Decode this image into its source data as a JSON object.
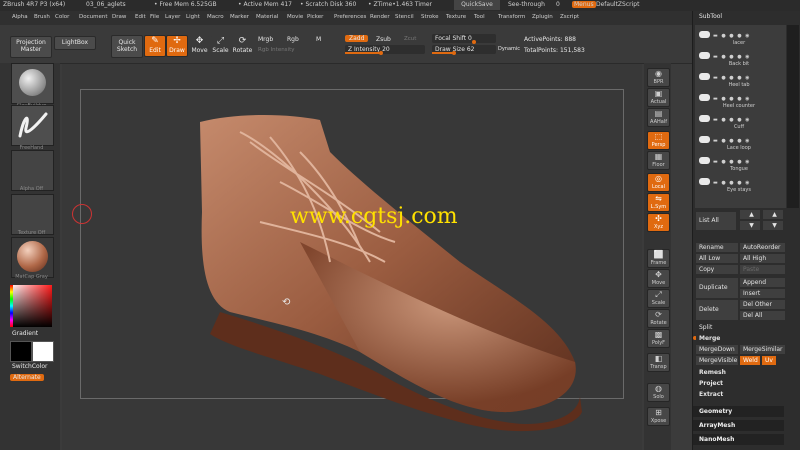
{
  "titlebar": {
    "app_info": "ZBrush 4R7 P3 (x64)",
    "file_name": "03_06_aglets",
    "free_mem": "• Free Mem 6.525GB",
    "active_mem": "• Active Mem 417",
    "scratch": "• Scratch Disk 360",
    "ztime": "• ZTime•1.463 Timer",
    "quicksave": "QuickSave",
    "seethrough": "See-through",
    "seethrough_val": "0",
    "menus": "Menus",
    "script": "DefaultZScript"
  },
  "menubar": [
    "Alpha",
    "Brush",
    "Color",
    "Document",
    "Draw",
    "Edit",
    "File",
    "Layer",
    "Light",
    "Macro",
    "Marker",
    "Material",
    "Movie",
    "Picker",
    "Preferences",
    "Render",
    "Stencil",
    "Stroke",
    "Texture",
    "Tool",
    "Transform",
    "Zplugin",
    "Zscript"
  ],
  "toolbar": {
    "projection_master": "Projection Master",
    "lightbox": "LightBox",
    "quick_sketch": "Quick Sketch",
    "edit": "Edit",
    "draw": "Draw",
    "move": "Move",
    "scale": "Scale",
    "rotate": "Rotate",
    "mrgb": "Mrgb",
    "rgb": "Rgb",
    "m": "M",
    "rgb_intensity": "Rgb Intensity",
    "zadd": "Zadd",
    "zsub": "Zsub",
    "zcut": "Zcut",
    "z_intensity_label": "Z Intensity",
    "z_intensity_val": "20",
    "focal_shift_label": "Focal Shift",
    "focal_shift_val": "0",
    "draw_size_label": "Draw Size",
    "draw_size_val": "62",
    "dynamic": "Dynamic",
    "active_points": "ActivePoints: 888",
    "total_points": "TotalPoints: 151,583"
  },
  "left": {
    "brush": "ClayBuildup",
    "stroke": "FreeHand",
    "alpha": "Alpha Off",
    "texture": "Texture Off",
    "material": "MatCap Gray",
    "gradient": "Gradient",
    "switchcolor": "SwitchColor",
    "alternate": "Alternate"
  },
  "watermark": "www.cgtsj.com",
  "right_shelf": [
    "BPR",
    "Actual",
    "AAHalf",
    "Persp",
    "Floor",
    "Local",
    "L.Sym",
    "Xyz",
    "Frame",
    "Move",
    "Scale",
    "Rotate",
    "PolyF",
    "Transp",
    "Solo",
    "Xpose"
  ],
  "subtool": {
    "header": "SubTool",
    "items": [
      "lacer",
      "Back bit",
      "Heel tab",
      "Heel counter",
      "Cuff",
      "Lace loop",
      "Tongue",
      "Eye stays"
    ],
    "list_all": "List All",
    "buttons": {
      "rename": "Rename",
      "autoreorder": "AutoReorder",
      "all_low": "All Low",
      "all_high": "All High",
      "copy": "Copy",
      "paste": "Paste",
      "duplicate": "Duplicate",
      "append": "Append",
      "insert": "Insert",
      "delete": "Delete",
      "del_other": "Del Other",
      "del_all": "Del All",
      "split": "Split",
      "merge": "Merge",
      "mergedown": "MergeDown",
      "mergesimilar": "MergeSimilar",
      "mergevisible": "MergeVisible",
      "weld": "Weld",
      "uv": "Uv",
      "remesh": "Remesh",
      "project": "Project",
      "extract": "Extract"
    },
    "sections": [
      "Geometry",
      "ArrayMesh",
      "NanoMesh"
    ]
  },
  "colors": {
    "accent": "#e06a10",
    "model": "#9a5c40"
  }
}
